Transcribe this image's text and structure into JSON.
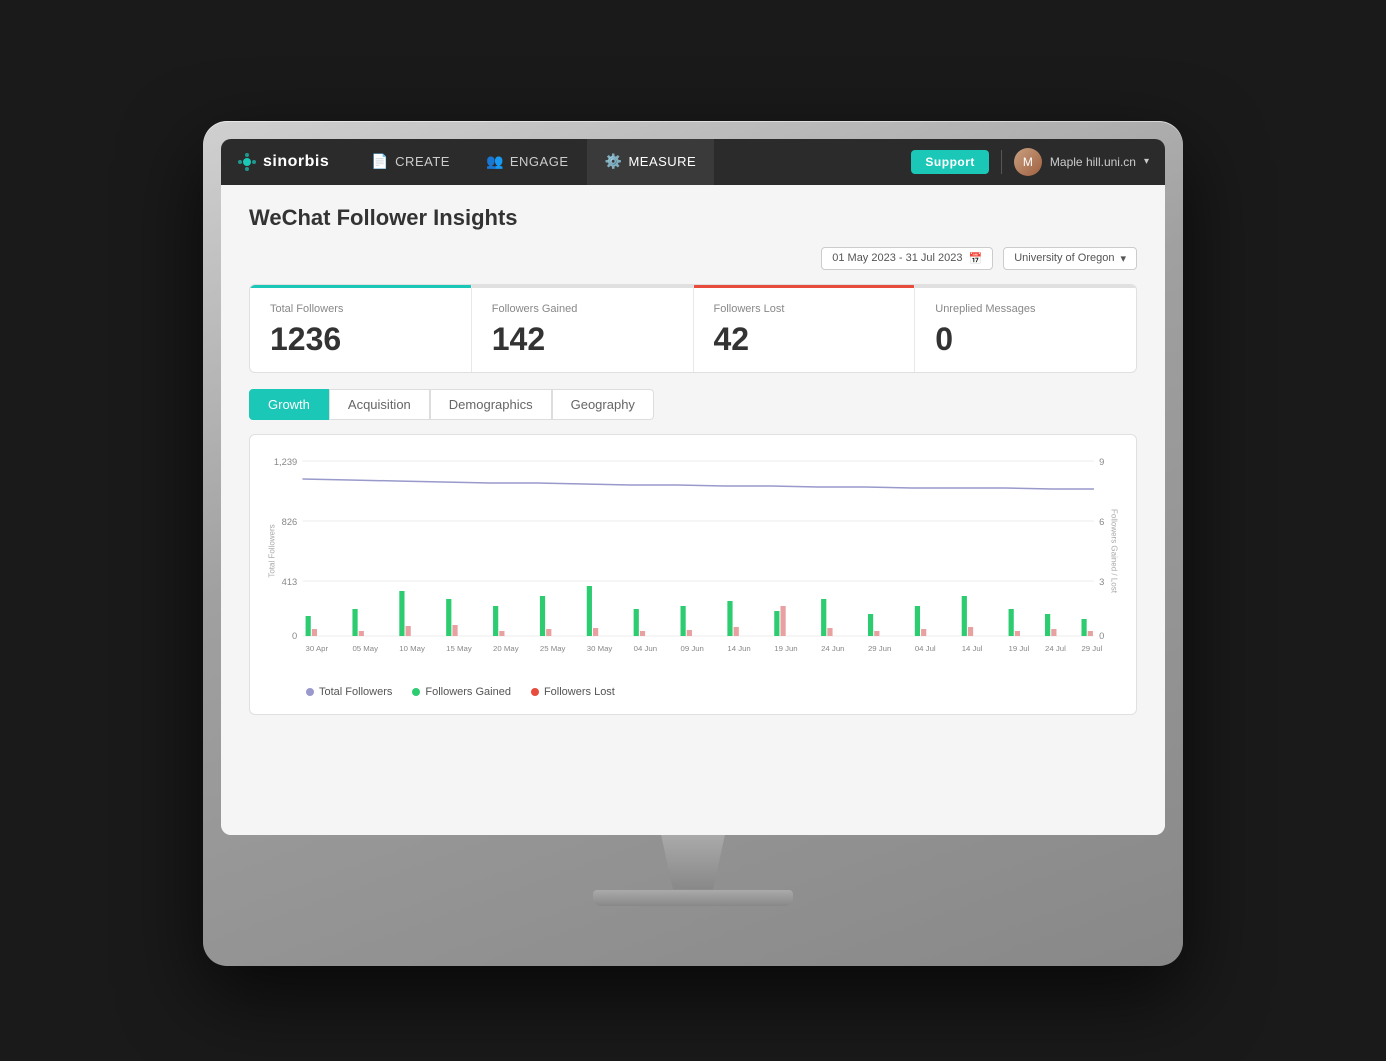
{
  "app": {
    "logo": "sinorbis",
    "nav_items": [
      {
        "label": "CREATE",
        "icon": "📄",
        "active": false
      },
      {
        "label": "ENGAGE",
        "icon": "👥",
        "active": false
      },
      {
        "label": "MEASURE",
        "icon": "⚙️",
        "active": true
      }
    ],
    "support_label": "Support",
    "user_name": "Maple hill.uni.cn",
    "chevron": "▾"
  },
  "page": {
    "title": "WeChat Follower Insights",
    "date_range": "01 May 2023 - 31 Jul 2023",
    "org": "University of Oregon"
  },
  "stats": {
    "total_followers_label": "Total Followers",
    "total_followers_value": "1236",
    "followers_gained_label": "Followers Gained",
    "followers_gained_value": "142",
    "followers_lost_label": "Followers Lost",
    "followers_lost_value": "42",
    "unreplied_label": "Unreplied Messages",
    "unreplied_value": "0"
  },
  "tabs": [
    {
      "label": "Growth",
      "active": true
    },
    {
      "label": "Acquisition",
      "active": false
    },
    {
      "label": "Demographics",
      "active": false
    },
    {
      "label": "Geography",
      "active": false
    }
  ],
  "chart": {
    "y_axis_left_label": "Total Followers",
    "y_axis_right_label": "Followers Gained / Lost",
    "y_left_values": [
      "1,239",
      "826",
      "413",
      "0"
    ],
    "y_right_values": [
      "9",
      "6",
      "3",
      "0"
    ],
    "x_labels": [
      "30 Apr",
      "05 May",
      "10 May",
      "15 May",
      "20 May",
      "25 May",
      "30 May",
      "04 Jun",
      "09 Jun",
      "14 Jun",
      "19 Jun",
      "24 Jun",
      "29 Jun",
      "04 Jul",
      "14 Jul",
      "19 Jul",
      "24 Jul",
      "29 Jul"
    ]
  },
  "legend": {
    "total_followers": "Total Followers",
    "followers_gained": "Followers Gained",
    "followers_lost": "Followers Lost"
  },
  "colors": {
    "teal": "#1bc8b8",
    "green": "#2ecc71",
    "red": "#e74c3c",
    "blue_line": "#8888cc",
    "gray": "#cccccc"
  }
}
